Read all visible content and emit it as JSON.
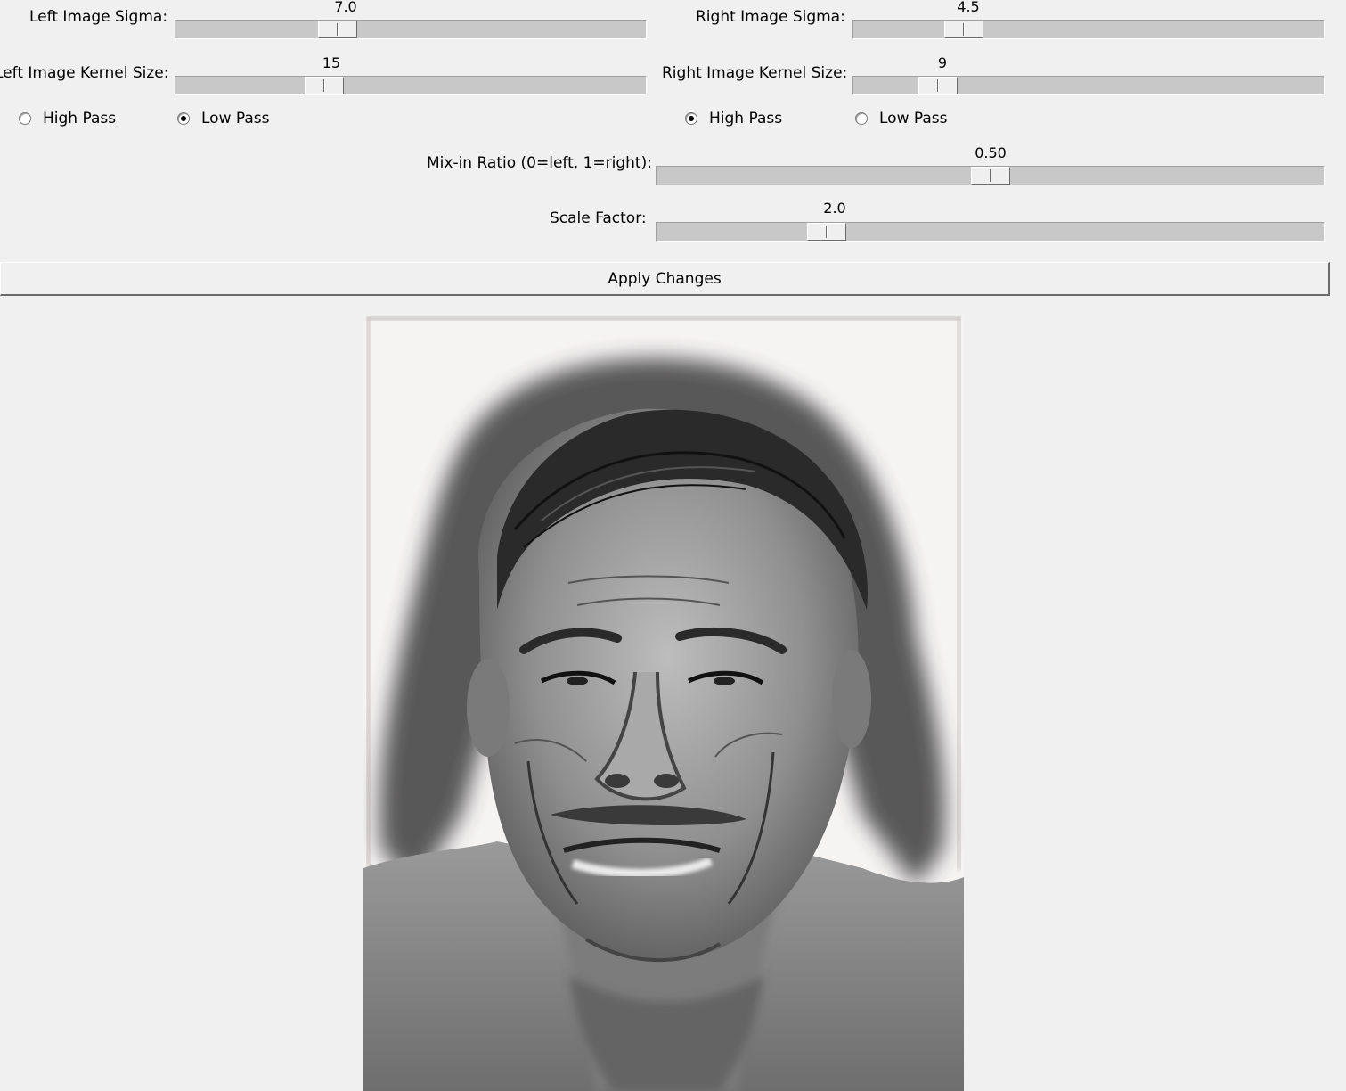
{
  "left": {
    "sigma_label": "Left Image Sigma:",
    "sigma_value": "7.0",
    "sigma_fraction": 0.33,
    "kernel_label": "Left Image Kernel Size:",
    "kernel_value": "15",
    "kernel_fraction": 0.3,
    "filters": [
      {
        "label": "High Pass",
        "selected": false
      },
      {
        "label": "Low Pass",
        "selected": true
      }
    ]
  },
  "right": {
    "sigma_label": "Right Image Sigma:",
    "sigma_value": "4.5",
    "sigma_fraction": 0.21,
    "kernel_label": "Right Image Kernel Size:",
    "kernel_value": "9",
    "kernel_fraction": 0.15,
    "filters": [
      {
        "label": "High Pass",
        "selected": true
      },
      {
        "label": "Low Pass",
        "selected": false
      }
    ]
  },
  "mix": {
    "label": "Mix-in Ratio (0=left, 1=right):",
    "value": "0.50",
    "fraction": 0.5
  },
  "scale": {
    "label": "Scale Factor:",
    "value": "2.0",
    "fraction": 0.24
  },
  "apply_button": "Apply Changes",
  "result_image": {
    "description_icon": "hybrid-face-image"
  }
}
